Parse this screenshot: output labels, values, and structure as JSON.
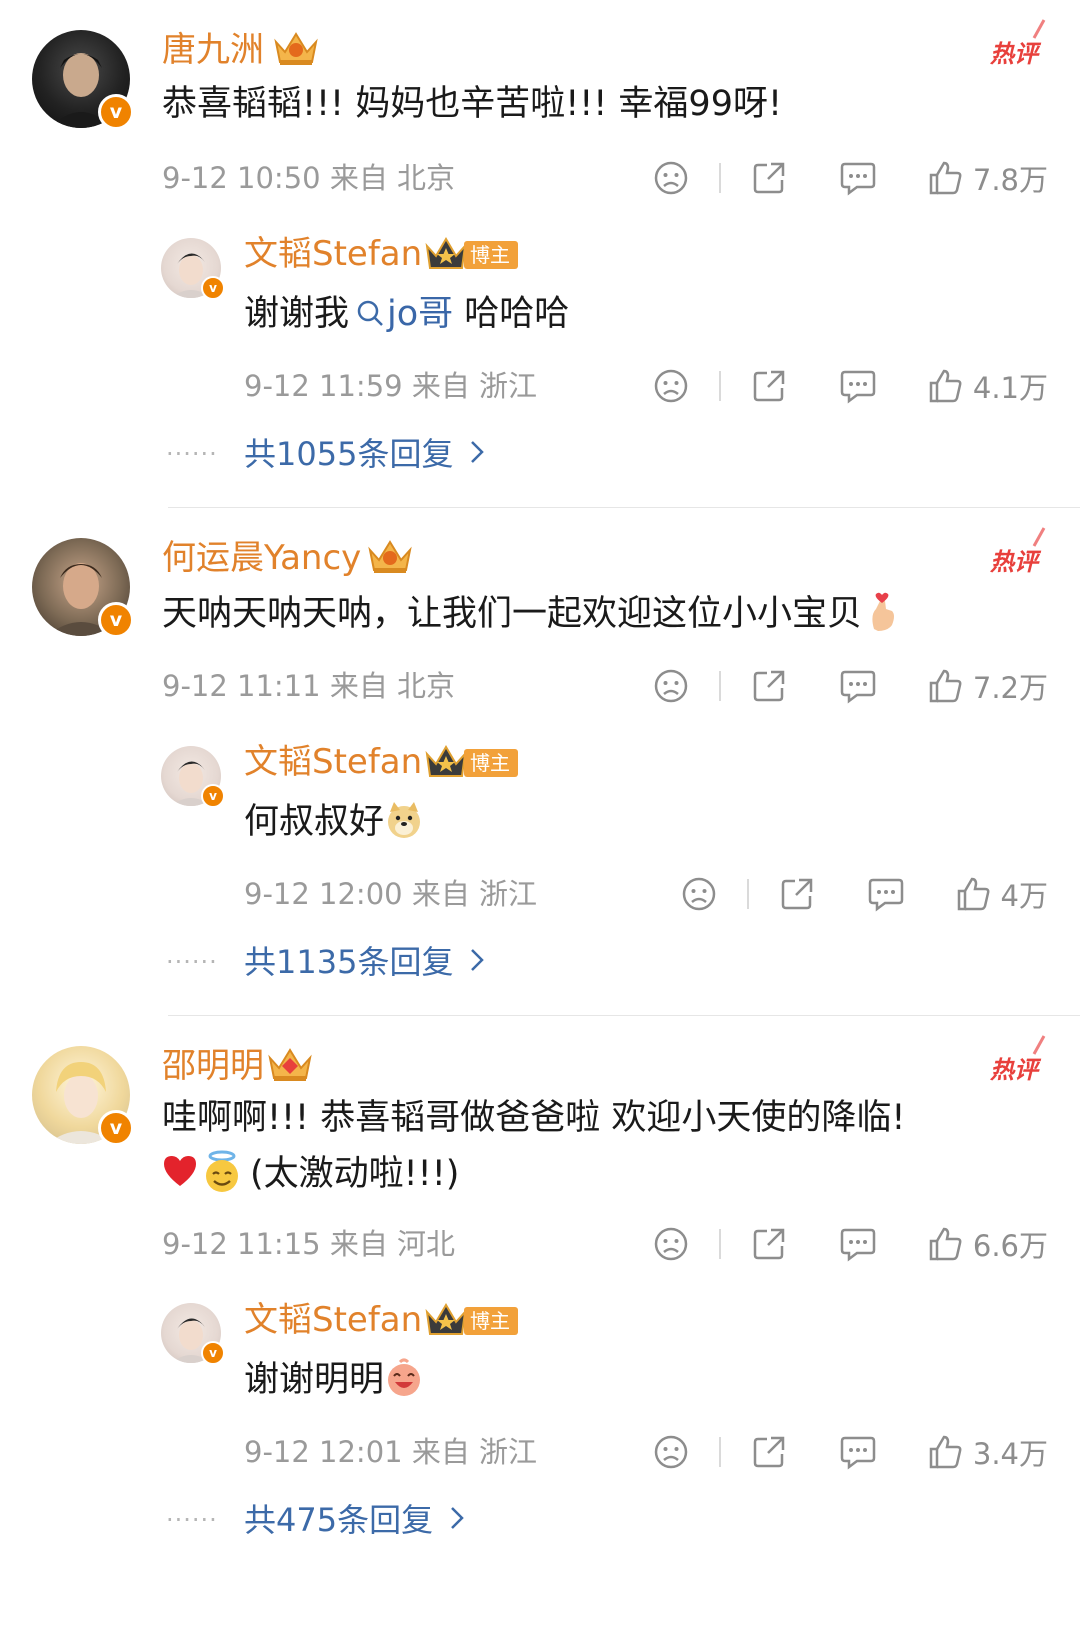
{
  "threads": [
    {
      "comment": {
        "user": "唐九洲",
        "hot_badge": "热评",
        "text": "恭喜韬韬!!! 妈妈也辛苦啦!!! 幸福99呀!",
        "meta": "9-12 10:50 来自 北京",
        "likes": "7.8万"
      },
      "reply": {
        "user": "文韬Stefan",
        "tag": "博主",
        "text_prefix": "谢谢我",
        "mention": "jo哥",
        "text_suffix": " 哈哈哈",
        "meta": "9-12 11:59 来自 浙江",
        "likes": "4.1万"
      },
      "more_replies": "共1055条回复",
      "dots": "······"
    },
    {
      "comment": {
        "user": "何运晨Yancy",
        "hot_badge": "热评",
        "text": "天呐天呐天呐，让我们一起欢迎这位小小宝贝",
        "meta": "9-12 11:11 来自 北京",
        "likes": "7.2万"
      },
      "reply": {
        "user": "文韬Stefan",
        "tag": "博主",
        "text": "何叔叔好",
        "meta": "9-12 12:00 来自 浙江",
        "likes": "4万"
      },
      "more_replies": "共1135条回复",
      "dots": "······"
    },
    {
      "comment": {
        "user": "邵明明",
        "hot_badge": "热评",
        "text": "哇啊啊!!! 恭喜韬哥做爸爸啦 欢迎小天使的降临!",
        "text_line2": "(太激动啦!!!)",
        "meta": "9-12 11:15 来自 河北",
        "likes": "6.6万"
      },
      "reply": {
        "user": "文韬Stefan",
        "tag": "博主",
        "text": "谢谢明明",
        "meta": "9-12 12:01 来自 浙江",
        "likes": "3.4万"
      },
      "more_replies": "共475条回复",
      "dots": "······"
    }
  ],
  "icons": {
    "verified": "v-badge-icon",
    "crown": "crown-icon",
    "dislike": "sad-face-icon",
    "share": "share-icon",
    "comment": "comment-icon",
    "like": "thumbs-up-icon",
    "search": "search-icon",
    "chevron": "chevron-right-icon"
  },
  "colors": {
    "username": "#e1822b",
    "link": "#3c6aa8",
    "hot": "#e8403c",
    "meta": "#9a9a9a",
    "verified": "#f08300"
  }
}
